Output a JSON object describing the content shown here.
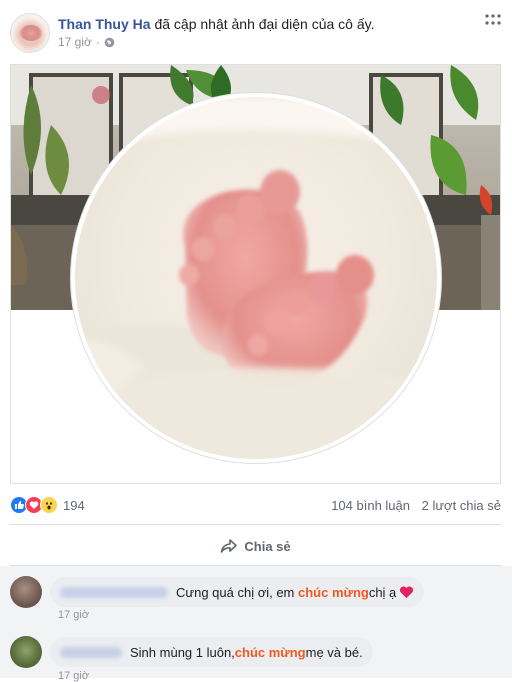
{
  "post": {
    "author": "Than Thuy Ha",
    "action": "đã cập nhật ảnh đại diện của cô ấy.",
    "time": "17 giờ"
  },
  "engagement": {
    "reaction_count": "194",
    "comments": "104 bình luận",
    "shares": "2 lượt chia sẻ"
  },
  "actions": {
    "share_label": "Chia sẻ"
  },
  "comments": [
    {
      "before": "Cưng quá chị ơi, em ",
      "highlight": "chúc mừng",
      "after": " chị ạ",
      "time": "17 giờ"
    },
    {
      "before": "Sinh mùng 1 luôn, ",
      "highlight": "chúc mừng",
      "after": " mẹ và bé.",
      "time": "17 giờ"
    }
  ],
  "colors": {
    "author_link": "#365899",
    "highlight": "#f05a22",
    "like": "#2078f4",
    "love": "#f33e58",
    "wow": "#fcd34c"
  }
}
